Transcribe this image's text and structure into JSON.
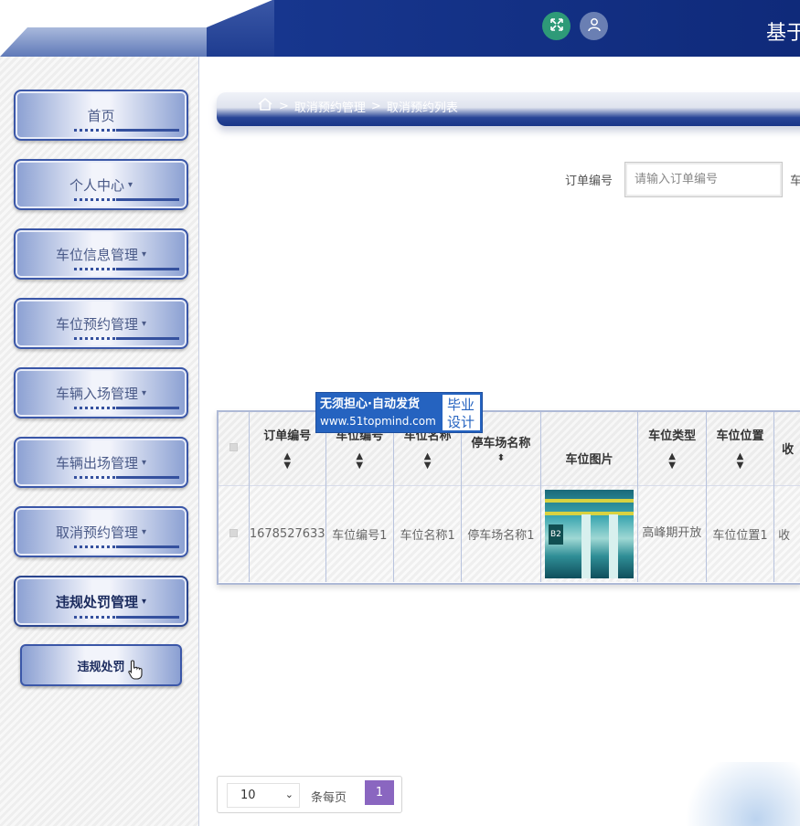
{
  "header": {
    "title": "基于",
    "expand_icon": "expand-icon",
    "user_icon": "user-icon",
    "colors": {
      "brand": "#17368e",
      "expand": "#2e9a78",
      "user": "#6a7fb3"
    }
  },
  "sidebar": {
    "items": [
      {
        "label": "首页",
        "caret": ""
      },
      {
        "label": "个人中心",
        "caret": "▾"
      },
      {
        "label": "车位信息管理",
        "caret": "▾"
      },
      {
        "label": "车位预约管理",
        "caret": "▾"
      },
      {
        "label": "车辆入场管理",
        "caret": "▾"
      },
      {
        "label": "车辆出场管理",
        "caret": "▾"
      },
      {
        "label": "取消预约管理",
        "caret": "▾"
      },
      {
        "label": "违规处罚管理",
        "caret": "▾"
      }
    ],
    "sub_item": {
      "label": "违规处罚"
    }
  },
  "breadcrumb": {
    "home_icon": "home-icon",
    "sep1": ">",
    "level1": "取消预约管理",
    "sep2": ">",
    "level2": "取消预约列表"
  },
  "search": {
    "order_label": "订单编号",
    "order_placeholder": "请输入订单编号",
    "next_label": "车"
  },
  "table": {
    "headers": [
      "订单编号",
      "车位编号",
      "车位名称",
      "停车场名称",
      "车位图片",
      "车位类型",
      "车位位置",
      "收"
    ],
    "sort_icon": "sort-icon",
    "rows": [
      {
        "order_no": "1678527633",
        "space_no": "车位编号1",
        "space_name": "车位名称1",
        "lot_name": "停车场名称1",
        "image_tag": "B2",
        "space_type": "高峰期开放",
        "space_location": "车位位置1",
        "fee": "收"
      }
    ]
  },
  "watermark": {
    "line1": "无须担心·自动发货",
    "url": "www.51topmind.com",
    "right_line1": "毕业",
    "right_line2": "设计"
  },
  "pagination": {
    "page_size": "10",
    "per_page_label": "条每页",
    "current_page": "1"
  }
}
